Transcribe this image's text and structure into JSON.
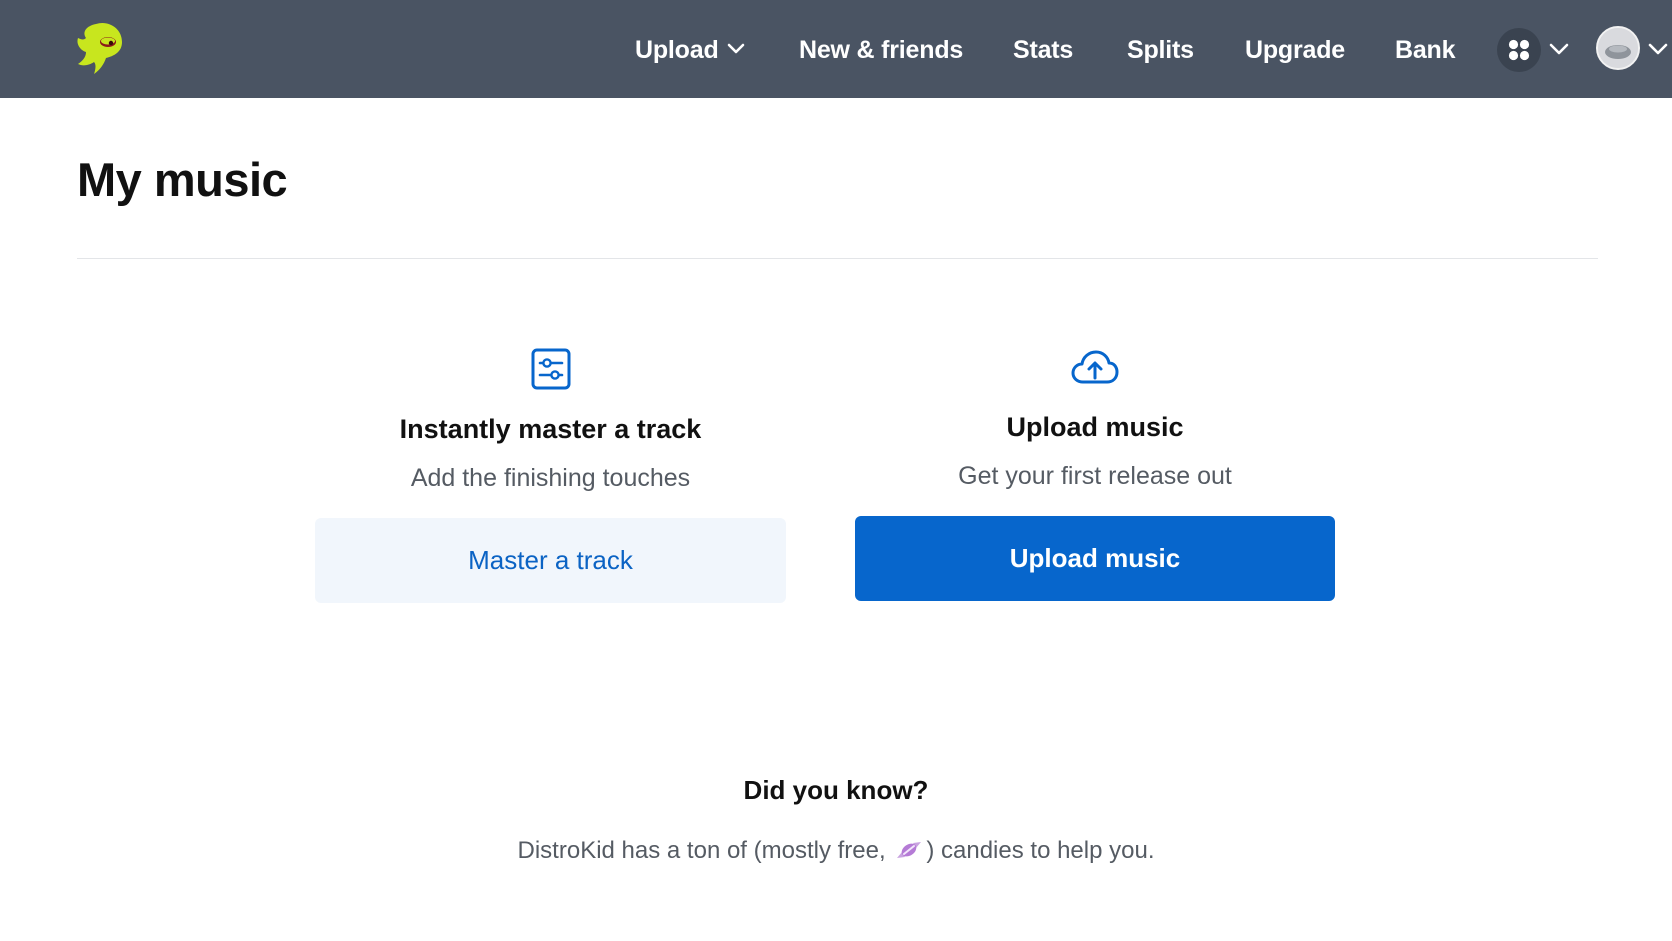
{
  "header": {
    "logo_icon": "distrokid-mascot-icon",
    "nav": {
      "upload": "Upload",
      "new_friends": "New & friends",
      "stats": "Stats",
      "splits": "Splits",
      "upgrade": "Upgrade",
      "bank": "Bank"
    },
    "apps_icon": "apps-grid-icon",
    "avatar_icon": "user-avatar"
  },
  "main": {
    "title": "My music",
    "cards": {
      "master": {
        "icon": "sliders-icon",
        "title": "Instantly master a track",
        "subtitle": "Add the finishing touches",
        "button": "Master a track"
      },
      "upload": {
        "icon": "cloud-upload-icon",
        "title": "Upload music",
        "subtitle": "Get your first release out",
        "button": "Upload music"
      }
    },
    "did_you_know": {
      "title": "Did you know?",
      "text_before": "DistroKid has a ton of (mostly free,",
      "text_after": ") candies to help you.",
      "candy_icon": "candy-icon"
    }
  },
  "colors": {
    "header_bg": "#4a5463",
    "accent": "#0766cc",
    "logo": "#c8e61e"
  }
}
